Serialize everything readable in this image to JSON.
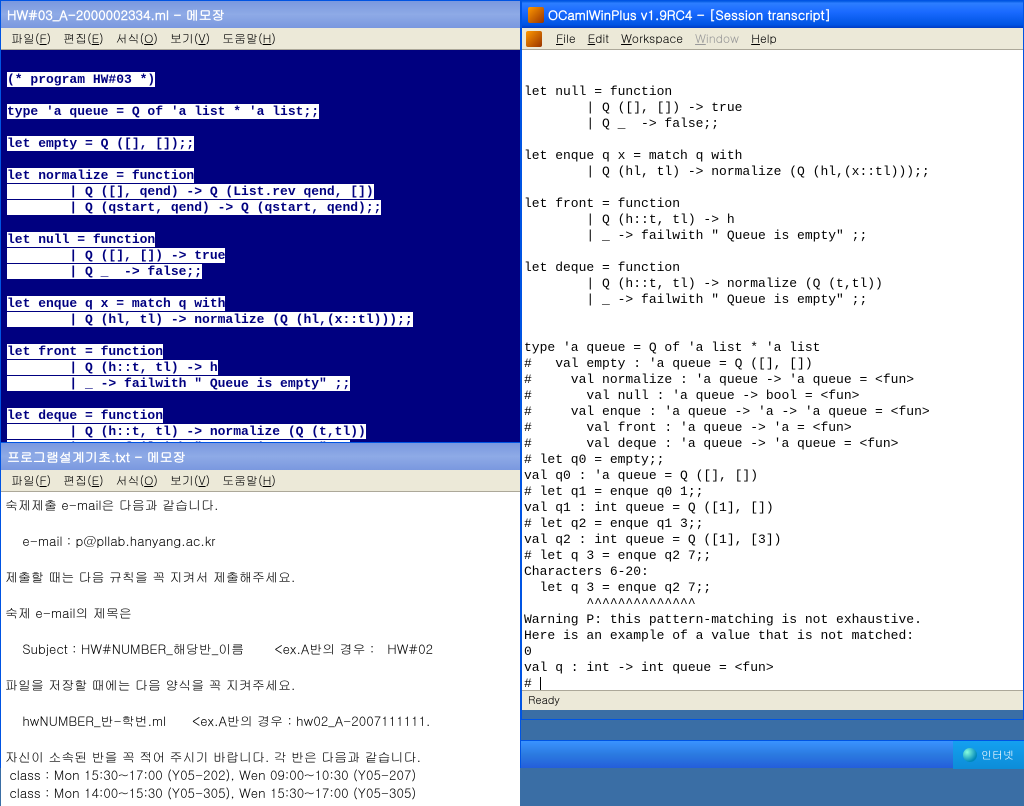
{
  "win1": {
    "title": "HW#03_A-2000002334.ml - 메모장",
    "menu": [
      "파일(F)",
      "편집(E)",
      "서식(O)",
      "보기(V)",
      "도움말(H)"
    ],
    "lines": [
      "",
      "(* program HW#03 *)",
      "",
      "type 'a queue = Q of 'a list * 'a list;;",
      "",
      "let empty = Q ([], []);;",
      "",
      "let normalize = function",
      "        | Q ([], qend) -> Q (List.rev qend, [])",
      "        | Q (qstart, qend) -> Q (qstart, qend);;",
      "",
      "let null = function",
      "        | Q ([], []) -> true",
      "        | Q _  -> false;;",
      "",
      "let enque q x = match q with",
      "        | Q (hl, tl) -> normalize (Q (hl,(x::tl)));;",
      "",
      "let front = function",
      "        | Q (h::t, tl) -> h",
      "        | _ -> failwith \" Queue is empty\" ;;",
      "",
      "let deque = function",
      "        | Q (h::t, tl) -> normalize (Q (t,tl))",
      "        | _ -> failwith \" Queue is empty\" ;;"
    ]
  },
  "win2": {
    "title": "프로그램설계기초.txt - 메모장",
    "menu": [
      "파일(F)",
      "편집(E)",
      "서식(O)",
      "보기(V)",
      "도움말(H)"
    ],
    "body": "숙제제출 e-mail은 다음과 같습니다.\n\n    e-mail : p@pllab.hanyang.ac.kr\n\n제출할 때는 다음 규칙을 꼭 지켜서 제출해주세요.\n\n숙제 e-mail의 제목은\n\n    Subject : HW#NUMBER_해당반_이름       <ex.A반의 경우 :   HW#02\n\n파일을 저장할 때에는 다음 양식을 꼭 지켜주세요.\n\n    hwNUMBER_반-학번.ml      <ex.A반의 경우 : hw02_A-2007111111.\n\n자신이 소속된 반을 꼭 적어 주시기 바랍니다. 각 반은 다음과 같습니다.\n class : Mon 15:30~17:00 (Y05-202), Wen 09:00~10:30 (Y05-207)\n class : Mon 14:00~15:30 (Y05-305), Wen 15:30~17:00 (Y05-305)"
  },
  "win3": {
    "title": "OCamlWinPlus v1.9RC4 -  [Session transcript]",
    "menu": [
      "File",
      "Edit",
      "Workspace",
      "Window",
      "Help"
    ],
    "body": "\nlet null = function\n        | Q ([], []) -> true\n        | Q _  -> false;;\n\nlet enque q x = match q with\n        | Q (hl, tl) -> normalize (Q (hl,(x::tl)));;\n\nlet front = function\n        | Q (h::t, tl) -> h\n        | _ -> failwith \" Queue is empty\" ;;\n\nlet deque = function\n        | Q (h::t, tl) -> normalize (Q (t,tl))\n        | _ -> failwith \" Queue is empty\" ;;\n\n\ntype 'a queue = Q of 'a list * 'a list\n#   val empty : 'a queue = Q ([], [])\n#     val normalize : 'a queue -> 'a queue = <fun>\n#       val null : 'a queue -> bool = <fun>\n#     val enque : 'a queue -> 'a -> 'a queue = <fun>\n#       val front : 'a queue -> 'a = <fun>\n#       val deque : 'a queue -> 'a queue = <fun>\n# let q0 = empty;;\nval q0 : 'a queue = Q ([], [])\n# let q1 = enque q0 1;;\nval q1 : int queue = Q ([1], [])\n# let q2 = enque q1 3;;\nval q2 : int queue = Q ([1], [3])\n# let q 3 = enque q2 7;;\nCharacters 6-20:\n  let q 3 = enque q2 7;;\n        ^^^^^^^^^^^^^^\nWarning P: this pattern-matching is not exhaustive.\nHere is an example of a value that is not matched:\n0\nval q : int -> int queue = <fun>\n# ",
    "status": "Ready"
  },
  "tray": {
    "label": "인터넷"
  }
}
